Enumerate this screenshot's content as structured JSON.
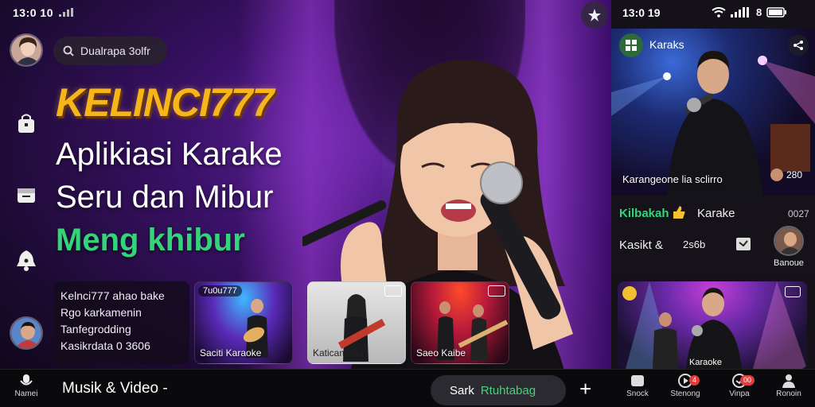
{
  "status_left": {
    "time": "13:0 10"
  },
  "status_right": {
    "time": "13:0 19",
    "battery": "8"
  },
  "search_pill": {
    "label": "Dualrapa 3olfr"
  },
  "hero": {
    "brand": "KELINCI777",
    "line1": "Aplikiasi Karake",
    "line2": "Seru dan Mibur",
    "line3": "Meng khibur"
  },
  "info_card": {
    "title": "Kelnci777",
    "title_suffix": "ahao bake",
    "line2": "Rgo karkamenin",
    "line3": "Tanfegrodding",
    "line4": "Kasikrdata 0 3606"
  },
  "thumbs": [
    {
      "tag": "7u0u777",
      "caption": "Saciti Karaoke"
    },
    {
      "tag": "",
      "caption": "Katicamond"
    },
    {
      "tag": "",
      "caption": "Saeo Kaibe"
    }
  ],
  "right_panel": {
    "channel": "Karaks",
    "video1_title": "Karangeone lia sclirro",
    "video1_count": "280",
    "row1_left": "Kilbakah",
    "row1_mid": "Karake",
    "row1_right": "0027",
    "row2_left": "Kasikt &",
    "row2_mid": "2s6b",
    "profile_label": "Banoue",
    "video2_caption": "Karaoke"
  },
  "bottom": {
    "left_nav": "Namei",
    "musik": "Musik & Video -",
    "search_prefix": "Sark",
    "search_highlight": "Rtuhtabag",
    "nav": [
      {
        "label": "Snock",
        "badge": ""
      },
      {
        "label": "Stenong",
        "badge": "4"
      },
      {
        "label": "Vinpa",
        "badge": "00"
      },
      {
        "label": "Ronoin",
        "badge": ""
      }
    ]
  },
  "colors": {
    "brand": "#f6b51a",
    "green": "#33d47a",
    "badge": "#e23c3c",
    "search_highlight": "#4cd07d"
  }
}
